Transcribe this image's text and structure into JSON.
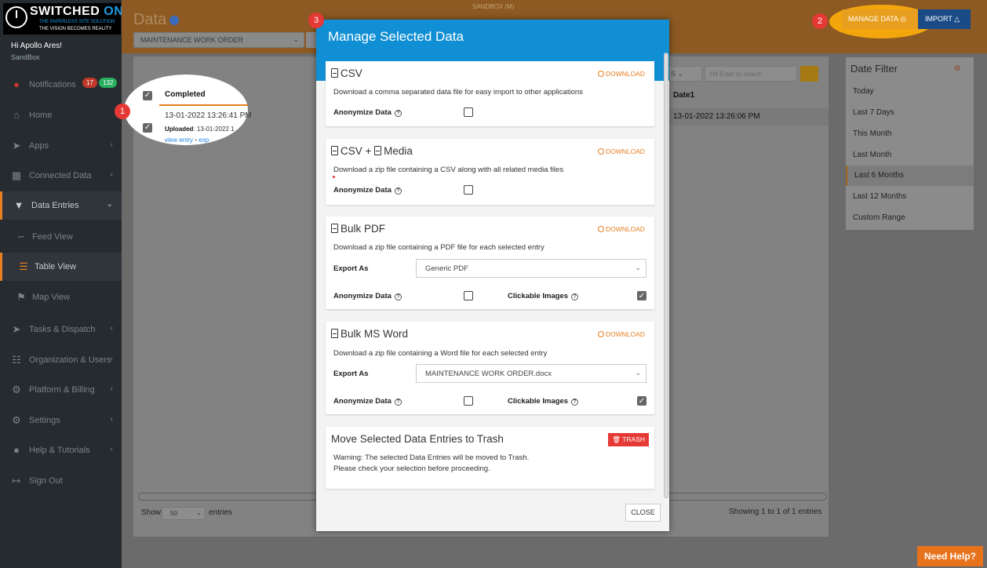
{
  "app": {
    "brand_main": "SWITCHED ",
    "brand_hl": "ON",
    "tagline1": "THE PAPERLESS SITE SOLUTION",
    "tagline2": "THE VISION BECOMES REALITY",
    "greeting": "Hi Apollo Ares!",
    "workspace": "SandBox",
    "environment": "SANDBOX (M)"
  },
  "sidebar": {
    "items": [
      {
        "label": "Notifications",
        "icon": "bell-icon"
      },
      {
        "label": "Home",
        "icon": "home-icon"
      },
      {
        "label": "Apps",
        "icon": "rocket-icon"
      },
      {
        "label": "Connected Data",
        "icon": "table-icon"
      },
      {
        "label": "Data Entries",
        "icon": "inbox-icon"
      },
      {
        "label": "Feed View",
        "icon": "rss-icon"
      },
      {
        "label": "Table View",
        "icon": "list-icon"
      },
      {
        "label": "Map View",
        "icon": "map-icon"
      },
      {
        "label": "Tasks & Dispatch",
        "icon": "send-icon"
      },
      {
        "label": "Organization & Users",
        "icon": "org-icon"
      },
      {
        "label": "Platform & Billing",
        "icon": "cogs-icon"
      },
      {
        "label": "Settings",
        "icon": "gear-icon"
      },
      {
        "label": "Help & Tutorials",
        "icon": "help-icon"
      },
      {
        "label": "Sign Out",
        "icon": "sign-out-icon"
      }
    ],
    "notif_red": "17",
    "notif_green": "132"
  },
  "page": {
    "title": "Data",
    "form_select": "MAINTENANCE WORK ORDER",
    "manage_btn": "MANAGE DATA",
    "import_btn": "IMPORT"
  },
  "table": {
    "search_placeholder": "Hit Enter to search",
    "col_selector": "S",
    "col_completed": "Completed",
    "col_date1": "Date1",
    "row_completed_ts": "13-01-2022 13:26:41 PM",
    "row_uploaded_label": "Uploaded",
    "row_uploaded_value": ": 13-01-2022 1",
    "row_link_view": "view entry",
    "row_link_sep": " • ",
    "row_link_export": "exp",
    "row_date1": "13-01-2022 13:26:06 PM",
    "show_label": "Show",
    "page_size": "50",
    "entries_label": "entries",
    "showing_text": "Showing 1 to 1 of 1 entries"
  },
  "date_filter": {
    "title": "Date Filter",
    "options": [
      "Today",
      "Last 7 Days",
      "This Month",
      "Last Month",
      "Last 6 Months",
      "Last 12 Months",
      "Custom Range"
    ],
    "active": "Last 6 Months"
  },
  "markers": [
    "1",
    "2",
    "3"
  ],
  "modal": {
    "title": "Manage Selected Data",
    "download_label": "DOWNLOAD",
    "anonymize_label": "Anonymize Data",
    "clickable_images_label": "Clickable Images",
    "export_as_label": "Export As",
    "help_glyph": "?",
    "csv": {
      "title": "CSV",
      "desc": "Download a comma separated data file for easy import to other applications",
      "anonymize": false
    },
    "csv_media": {
      "title": "CSV + ",
      "title_b": "Media",
      "desc": "Download a zip file containing a CSV along with all related media files",
      "anonymize": false
    },
    "bulk_pdf": {
      "title": "Bulk PDF",
      "desc": "Download a zip file containing a PDF file for each selected entry",
      "export_as": "Generic PDF",
      "anonymize": false,
      "clickable_images": true
    },
    "bulk_word": {
      "title": "Bulk MS Word",
      "desc": "Download a zip file containing a Word file for each selected entry",
      "export_as": "MAINTENANCE WORK ORDER.docx",
      "anonymize": false,
      "clickable_images": true
    },
    "trash": {
      "title": "Move Selected Data Entries to Trash",
      "button": "TRASH",
      "warning1": "Warning: The selected Data Entries will be moved to Trash.",
      "warning2": "Please check your selection before proceeding."
    },
    "close": "CLOSE"
  },
  "help_widget": "Need Help?",
  "colors": {
    "accent_orange": "#e67e22",
    "modal_blue": "#118fd4",
    "trash_red": "#e53935",
    "sidebar_bg": "#262b30"
  }
}
